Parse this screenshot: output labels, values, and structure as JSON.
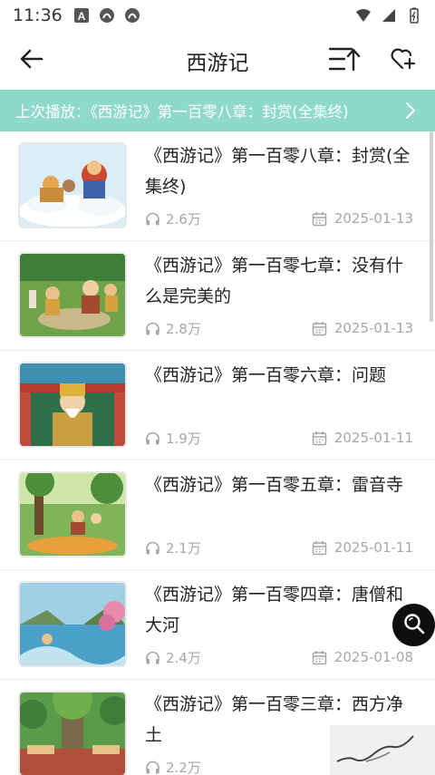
{
  "status_bar": {
    "time": "11:36",
    "left_icons": [
      "a-notification-icon",
      "ghost-app-icon",
      "ghost-app-icon"
    ],
    "right_icons": [
      "wifi-icon",
      "signal-icon",
      "battery-icon"
    ]
  },
  "header": {
    "title": "西游记",
    "back_icon": "back-arrow-icon",
    "sort_icon": "sort-icon",
    "favorite_icon": "heart-add-icon"
  },
  "last_play": {
    "text": "上次播放：《西游记》第一百零八章：封赏(全集终)",
    "arrow_icon": "chevron-right-icon",
    "background": "#8ed9c9"
  },
  "episodes": [
    {
      "title": "《西游记》第一百零八章：封赏(全集终)",
      "plays": "2.6万",
      "date": "2025-01-13"
    },
    {
      "title": "《西游记》第一百零七章：没有什么是完美的",
      "plays": "2.8万",
      "date": "2025-01-13"
    },
    {
      "title": "《西游记》第一百零六章：问题",
      "plays": "1.9万",
      "date": "2025-01-11"
    },
    {
      "title": "《西游记》第一百零五章：雷音寺",
      "plays": "2.1万",
      "date": "2025-01-11"
    },
    {
      "title": "《西游记》第一百零四章：唐僧和大河",
      "plays": "2.4万",
      "date": "2025-01-08"
    },
    {
      "title": "《西游记》第一百零三章：西方净土",
      "plays": "2.2万",
      "date": ""
    }
  ],
  "floating": {
    "search_icon": "search-icon"
  }
}
